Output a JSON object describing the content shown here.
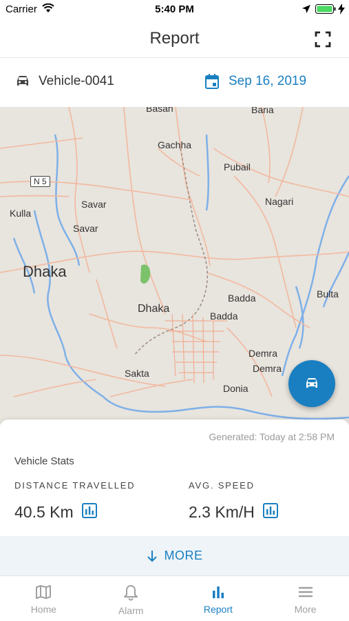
{
  "status_bar": {
    "carrier": "Carrier",
    "time": "5:40 PM"
  },
  "header": {
    "title": "Report"
  },
  "info_bar": {
    "vehicle": "Vehicle-0041",
    "date": "Sep 16, 2019"
  },
  "map": {
    "labels": {
      "basan": "Basan",
      "baria": "Baria",
      "gachha": "Gachha",
      "pubail": "Pubail",
      "n5": "N 5",
      "nagari": "Nagari",
      "kulla": "Kulla",
      "savar1": "Savar",
      "savar2": "Savar",
      "dhaka_big": "Dhaka",
      "dhaka": "Dhaka",
      "badda1": "Badda",
      "badda2": "Badda",
      "bulta": "Bulta",
      "demra1": "Demra",
      "demra2": "Demra",
      "sakta": "Sakta",
      "donia": "Donia"
    }
  },
  "panel": {
    "generated": "Generated: Today at 2:58 PM",
    "section_title": "Vehicle Stats",
    "distance_label": "DISTANCE TRAVELLED",
    "distance_value": "40.5 Km",
    "speed_label": "AVG. SPEED",
    "speed_value": "2.3 Km/H",
    "more_label": "MORE"
  },
  "tabs": [
    {
      "label": "Home",
      "icon": "map-icon"
    },
    {
      "label": "Alarm",
      "icon": "bell-icon"
    },
    {
      "label": "Report",
      "icon": "bar-chart-icon"
    },
    {
      "label": "More",
      "icon": "menu-icon"
    }
  ],
  "colors": {
    "accent": "#1a7fc1",
    "inactive": "#a0a0a0",
    "map_bg": "#e8e4de",
    "road": "#f0b9a0",
    "water": "#6aa6e6"
  }
}
